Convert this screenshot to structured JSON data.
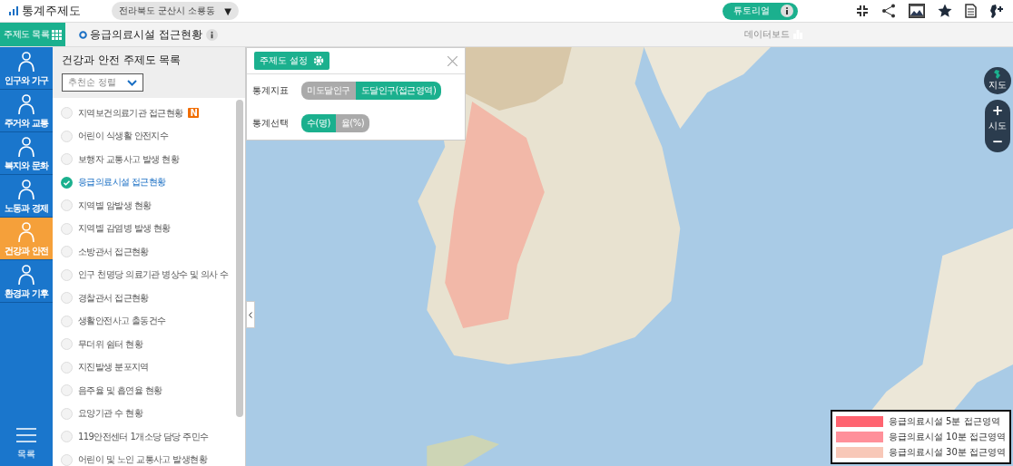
{
  "header": {
    "title": "통계주제도",
    "region": "전라북도 군산시 소룡동",
    "region_caret": "▼",
    "tutorial": "튜토리얼"
  },
  "subbar": {
    "menu_button": "주제도 목록",
    "current_title": "응급의료시설 접근현황",
    "dashboard": "데이터보드"
  },
  "nav": [
    {
      "label": "인구와 가구",
      "selected": false
    },
    {
      "label": "주거와 교통",
      "selected": false
    },
    {
      "label": "복지와 문화",
      "selected": false
    },
    {
      "label": "노동과 경제",
      "selected": false
    },
    {
      "label": "건강과 안전",
      "selected": true
    },
    {
      "label": "환경과 기후",
      "selected": false
    }
  ],
  "nav_bottom": "목록",
  "panel": {
    "title": "건강과 안전 주제도 목록",
    "sort": "추천순 정렬",
    "items": [
      {
        "label": "지역보건의료기관 접근현황",
        "selected": false,
        "badge": "N"
      },
      {
        "label": "어린이 식생활 안전지수",
        "selected": false
      },
      {
        "label": "보행자 교통사고 발생 현황",
        "selected": false
      },
      {
        "label": "응급의료시설 접근현황",
        "selected": true
      },
      {
        "label": "지역별 암발생 현황",
        "selected": false
      },
      {
        "label": "지역별 감염병 발생 현황",
        "selected": false
      },
      {
        "label": "소방관서 접근현황",
        "selected": false
      },
      {
        "label": "인구 천명당 의료기관 병상수 및 의사 수",
        "selected": false
      },
      {
        "label": "경찰관서 접근현황",
        "selected": false
      },
      {
        "label": "생활안전사고 출동건수",
        "selected": false
      },
      {
        "label": "무더위 쉼터 현황",
        "selected": false
      },
      {
        "label": "지진발생 분포지역",
        "selected": false
      },
      {
        "label": "음주율 및 흡연율 현황",
        "selected": false
      },
      {
        "label": "요양기관 수 현황",
        "selected": false
      },
      {
        "label": "119안전센터 1개소당 담당 주민수",
        "selected": false
      },
      {
        "label": "어린이 및 노인 교통사고 발생현황",
        "selected": false
      }
    ]
  },
  "settings": {
    "button": "주제도 설정",
    "rows": [
      {
        "label": "통계지표",
        "options": [
          {
            "label": "미도달인구",
            "selected": false
          },
          {
            "label": "도달인구(접근영역)",
            "selected": true
          }
        ]
      },
      {
        "label": "통계선택",
        "options": [
          {
            "label": "수(명)",
            "selected": true
          },
          {
            "label": "율(%)",
            "selected": false
          }
        ]
      }
    ]
  },
  "map_controls": {
    "map_type": "지도",
    "zoom_label": "시도",
    "zoom_in": "+",
    "zoom_out": "−"
  },
  "legend": [
    {
      "label": "응급의료시설 5분 접근영역",
      "color": "#ff6470"
    },
    {
      "label": "응급의료시설 10분 접근영역",
      "color": "#ff909a"
    },
    {
      "label": "응급의료시설 30분 접근영역",
      "color": "#f8c8b8"
    }
  ]
}
